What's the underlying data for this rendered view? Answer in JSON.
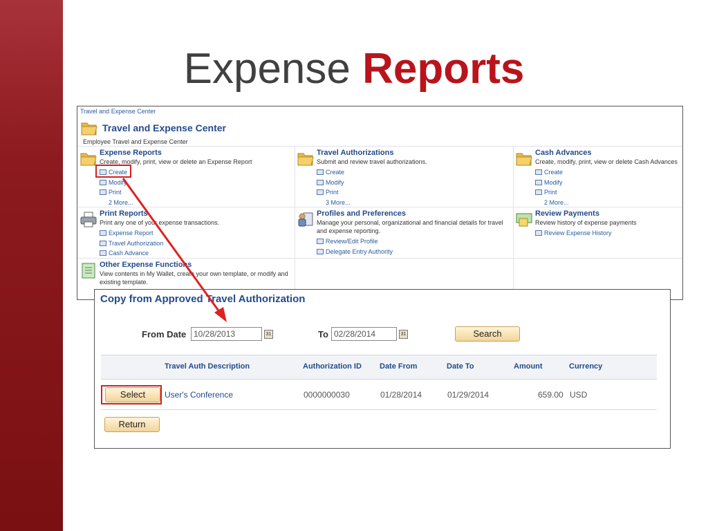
{
  "slide": {
    "title_plain": "Expense",
    "title_accent": "Reports",
    "colors": {
      "side_bar": "#8c1a1e",
      "accent": "#b8141c",
      "highlight": "#d42020"
    }
  },
  "center": {
    "breadcrumb": "Travel and Expense Center",
    "title": "Travel and Expense Center",
    "subtitle": "Employee Travel and Expense Center",
    "sections": [
      {
        "icon": "folder-icon",
        "title": "Expense Reports",
        "desc": "Create, modify, print, view or delete an Expense Report",
        "links": [
          "Create",
          "Modify",
          "Print"
        ],
        "more": "2 More..."
      },
      {
        "icon": "folder-icon",
        "title": "Travel Authorizations",
        "desc": "Submit and review travel authorizations.",
        "links": [
          "Create",
          "Modify",
          "Print"
        ],
        "more": "3 More..."
      },
      {
        "icon": "folder-icon",
        "title": "Cash Advances",
        "desc": "Create, modify, print, view or delete Cash Advances",
        "links": [
          "Create",
          "Modify",
          "Print"
        ],
        "more": "2 More..."
      },
      {
        "icon": "printer-icon",
        "title": "Print Reports",
        "desc": "Print any one of your expense transactions.",
        "links": [
          "Expense Report",
          "Travel Authorization",
          "Cash Advance"
        ]
      },
      {
        "icon": "profile-icon",
        "title": "Profiles and Preferences",
        "desc": "Manage your personal, organizational and financial details for travel and expense reporting.",
        "links": [
          "Review/Edit Profile",
          "Delegate Entry Authority"
        ]
      },
      {
        "icon": "payment-icon",
        "title": "Review Payments",
        "desc": "Review history of expense payments",
        "links": [
          "Review Expense History"
        ]
      },
      {
        "icon": "document-icon",
        "title": "Other Expense Functions",
        "desc": "View contents in My Wallet, create your own template, or modify and existing template.",
        "links": []
      }
    ]
  },
  "copy": {
    "title": "Copy from Approved Travel Authorization",
    "from_label": "From Date",
    "from_value": "10/28/2013",
    "to_label": "To",
    "to_value": "02/28/2014",
    "search_label": "Search",
    "calendar_glyph": "31",
    "columns": [
      "Travel Auth Description",
      "Authorization ID",
      "Date From",
      "Date To",
      "Amount",
      "Currency"
    ],
    "rows": [
      {
        "select_label": "Select",
        "description": "User's Conference",
        "auth_id": "0000000030",
        "date_from": "01/28/2014",
        "date_to": "01/29/2014",
        "amount": "659.00",
        "currency": "USD"
      }
    ],
    "return_label": "Return"
  }
}
